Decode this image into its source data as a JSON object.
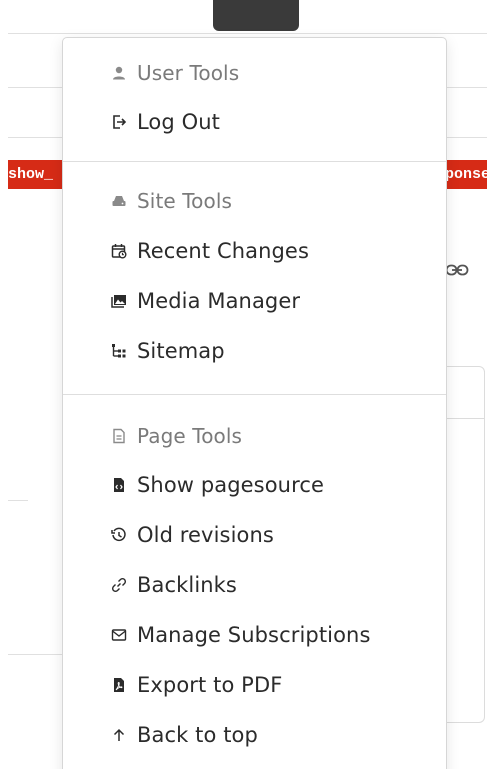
{
  "background": {
    "tag_left": "show_",
    "tag_right": "ponse"
  },
  "menu": {
    "sections": [
      {
        "header": {
          "label": "User Tools",
          "icon": "user-icon"
        },
        "items": [
          {
            "label": "Log Out",
            "icon": "logout-icon"
          }
        ]
      },
      {
        "header": {
          "label": "Site Tools",
          "icon": "site-tools-icon"
        },
        "items": [
          {
            "label": "Recent Changes",
            "icon": "recent-changes-icon"
          },
          {
            "label": "Media Manager",
            "icon": "media-manager-icon"
          },
          {
            "label": "Sitemap",
            "icon": "sitemap-icon"
          }
        ]
      },
      {
        "header": {
          "label": "Page Tools",
          "icon": "page-icon"
        },
        "items": [
          {
            "label": "Show pagesource",
            "icon": "pagesource-icon"
          },
          {
            "label": "Old revisions",
            "icon": "history-icon"
          },
          {
            "label": "Backlinks",
            "icon": "link-icon"
          },
          {
            "label": "Manage Subscriptions",
            "icon": "mail-icon"
          },
          {
            "label": "Export to PDF",
            "icon": "pdf-icon"
          },
          {
            "label": "Back to top",
            "icon": "arrow-up-icon"
          }
        ]
      }
    ]
  },
  "colors": {
    "tag_red": "#d62b16",
    "toggle_dark": "#3a3a3a",
    "menu_text": "#2b2b2b",
    "header_text": "#7a7a7a"
  }
}
